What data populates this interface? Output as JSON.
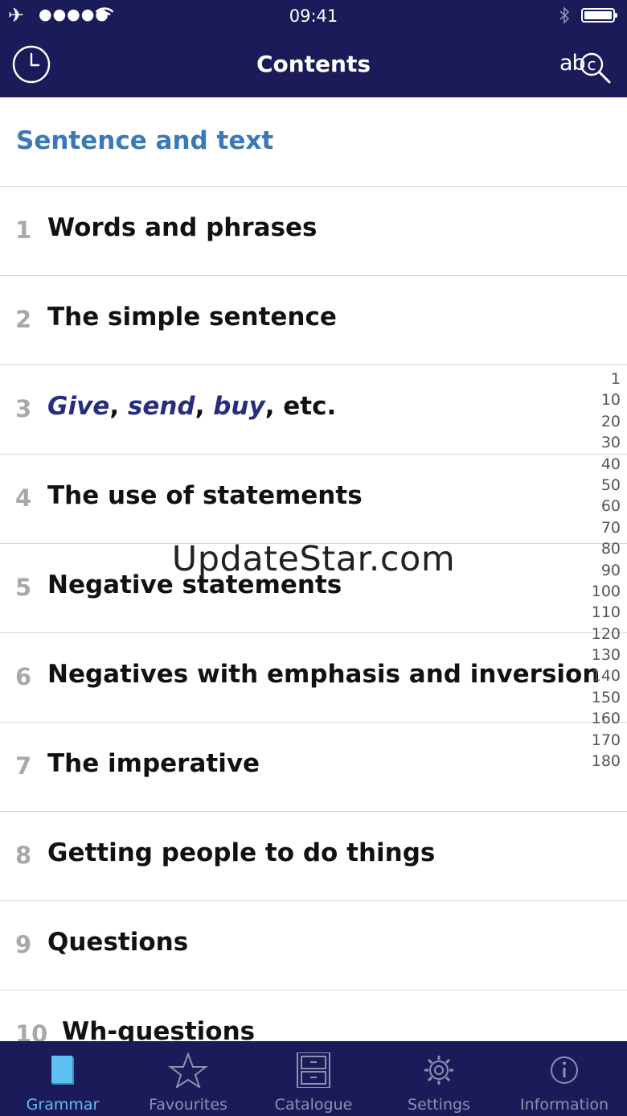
{
  "status_bar": {
    "time": "09:41",
    "signal": "●●●●●"
  },
  "nav": {
    "title": "Contents",
    "search_label": "ab"
  },
  "section": {
    "header": "Sentence and text"
  },
  "rows": [
    {
      "num": "1",
      "parts": [
        {
          "text": "Words and phrases",
          "italic": false
        }
      ]
    },
    {
      "num": "2",
      "parts": [
        {
          "text": "The simple sentence",
          "italic": false
        }
      ]
    },
    {
      "num": "3",
      "parts": [
        {
          "text": "Give",
          "italic": true
        },
        {
          "text": ", ",
          "italic": false
        },
        {
          "text": "send",
          "italic": true
        },
        {
          "text": ", ",
          "italic": false
        },
        {
          "text": "buy",
          "italic": true
        },
        {
          "text": ", etc.",
          "italic": false
        }
      ]
    },
    {
      "num": "4",
      "parts": [
        {
          "text": "The use of statements",
          "italic": false
        }
      ]
    },
    {
      "num": "5",
      "parts": [
        {
          "text": "Negative statements",
          "italic": false
        }
      ]
    },
    {
      "num": "6",
      "parts": [
        {
          "text": "Negatives with emphasis and inversion",
          "italic": false
        }
      ]
    },
    {
      "num": "7",
      "parts": [
        {
          "text": "The imperative",
          "italic": false
        }
      ]
    },
    {
      "num": "8",
      "parts": [
        {
          "text": "Getting people to do things",
          "italic": false
        }
      ]
    },
    {
      "num": "9",
      "parts": [
        {
          "text": "Questions",
          "italic": false
        }
      ]
    },
    {
      "num": "10",
      "parts": [
        {
          "text": "Wh-questions",
          "italic": false
        }
      ]
    }
  ],
  "index_strip": [
    "1",
    "10",
    "20",
    "30",
    "40",
    "50",
    "60",
    "70",
    "80",
    "90",
    "100",
    "110",
    "120",
    "130",
    "140",
    "150",
    "160",
    "170",
    "180"
  ],
  "watermark": "UpdateStar.com",
  "tabs": [
    {
      "label": "Grammar",
      "icon": "book-icon",
      "active": true
    },
    {
      "label": "Favourites",
      "icon": "star-icon",
      "active": false
    },
    {
      "label": "Catalogue",
      "icon": "cabinet-icon",
      "active": false
    },
    {
      "label": "Settings",
      "icon": "gear-icon",
      "active": false
    },
    {
      "label": "Information",
      "icon": "info-icon",
      "active": false
    }
  ],
  "colors": {
    "bar": "#1c1b5a",
    "section_header": "#3a78b6",
    "italic_text": "#262f7e",
    "active_tab": "#5ec0f0",
    "inactive_tab": "#8f8fae"
  }
}
